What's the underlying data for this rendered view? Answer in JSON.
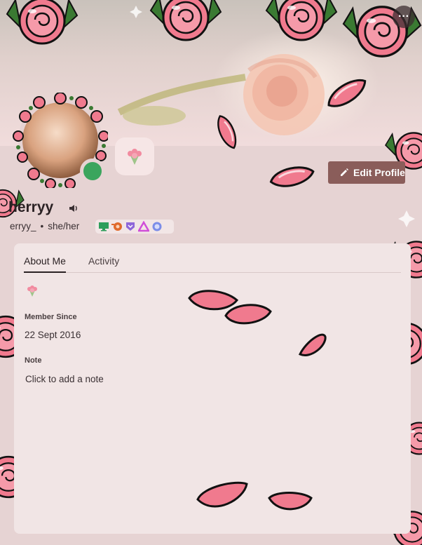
{
  "header": {
    "more_button_label": "···"
  },
  "profile": {
    "display_name": "herryy",
    "username": "erryy_",
    "separator": "•",
    "pronouns": "she/her",
    "status": "online",
    "status_color": "#3ba55d"
  },
  "actions": {
    "edit_profile_label": "Edit Profile"
  },
  "badges": [
    {
      "name": "active-developer-badge",
      "color": "#2e9e5b"
    },
    {
      "name": "hypesquad-bravery-badge",
      "color": "#e06a2c"
    },
    {
      "name": "nitro-badge",
      "color": "#8f67d9"
    },
    {
      "name": "early-supporter-badge",
      "color": "#d04fd8"
    },
    {
      "name": "server-boost-badge",
      "color": "#7b8de8"
    }
  ],
  "tabs": [
    {
      "label": "About Me",
      "active": true
    },
    {
      "label": "Activity",
      "active": false
    }
  ],
  "about": {
    "member_since_label": "Member Since",
    "member_since_value": "22 Sept 2016",
    "note_label": "Note",
    "note_placeholder": "Click to add a note"
  },
  "colors": {
    "edit_button_bg": "#8a5d5a",
    "panel_bg": "#f1e5e5",
    "petal": "#f07a8e",
    "rose_leaf": "#3a7a32"
  }
}
